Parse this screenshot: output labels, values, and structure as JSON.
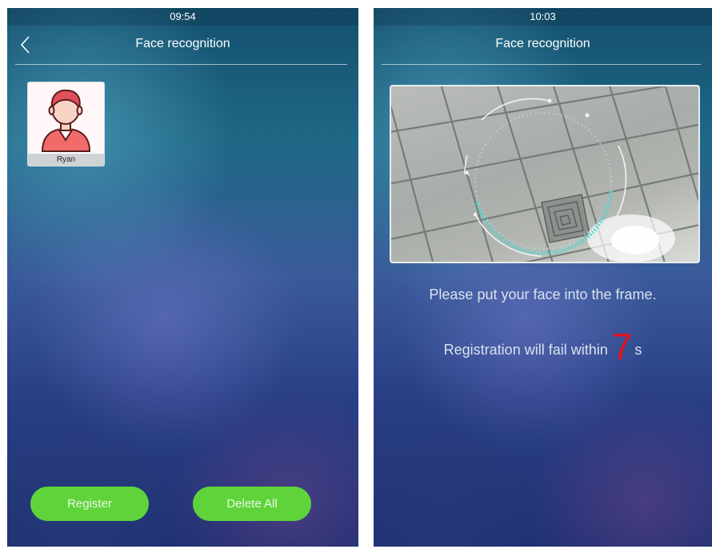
{
  "left_screen": {
    "status_time": "09:54",
    "title": "Face recognition",
    "users": [
      {
        "name": "Ryan"
      }
    ],
    "buttons": {
      "register": "Register",
      "delete_all": "Delete All"
    }
  },
  "right_screen": {
    "status_time": "10:03",
    "title": "Face recognition",
    "prompt": "Please put your face into the frame.",
    "countdown": {
      "prefix": "Registration will fail within",
      "seconds": "7",
      "unit": "s"
    }
  },
  "colors": {
    "button_green": "#5fd43a",
    "countdown_red": "#e0141c",
    "scan_cyan": "#4fd6d0",
    "avatar_red": "#e0505a"
  },
  "icons": {
    "back": "chevron-left-icon",
    "avatar": "user-avatar-icon"
  }
}
